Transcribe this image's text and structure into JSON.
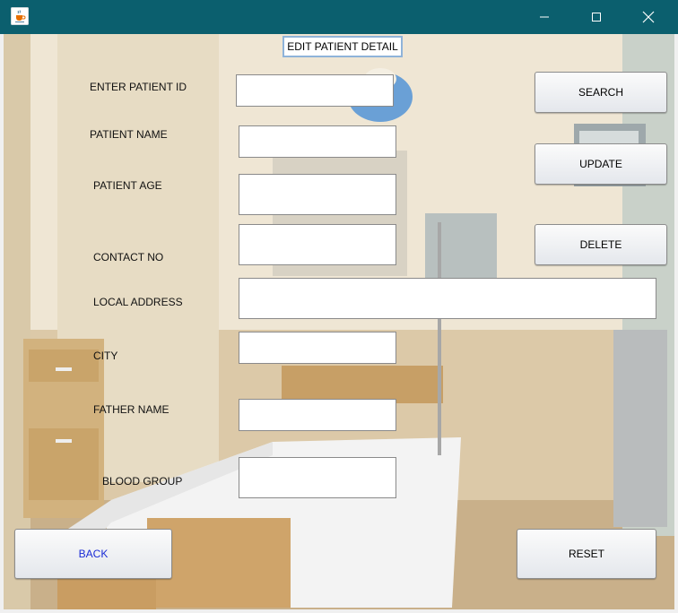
{
  "window": {
    "app_icon": "java-cup-icon",
    "minimize_icon": "minimize-icon",
    "maximize_icon": "maximize-icon",
    "close_icon": "close-icon",
    "titlebar_color": "#0b5f6e"
  },
  "form": {
    "heading": "EDIT PATIENT DETAIL",
    "fields": {
      "patient_id": {
        "label": "ENTER PATIENT ID",
        "value": ""
      },
      "patient_name": {
        "label": "PATIENT NAME",
        "value": ""
      },
      "patient_age": {
        "label": "PATIENT AGE",
        "value": ""
      },
      "contact_no": {
        "label": "CONTACT NO",
        "value": ""
      },
      "local_address": {
        "label": "LOCAL ADDRESS",
        "value": ""
      },
      "city": {
        "label": "CITY",
        "value": ""
      },
      "father_name": {
        "label": "FATHER NAME",
        "value": ""
      },
      "blood_group": {
        "label": "BLOOD GROUP",
        "value": ""
      }
    }
  },
  "buttons": {
    "search": "SEARCH",
    "update": "UPDATE",
    "delete": "DELETE",
    "back": "BACK",
    "reset": "RESET"
  },
  "background": {
    "description_icon": "hospital-room-background"
  }
}
